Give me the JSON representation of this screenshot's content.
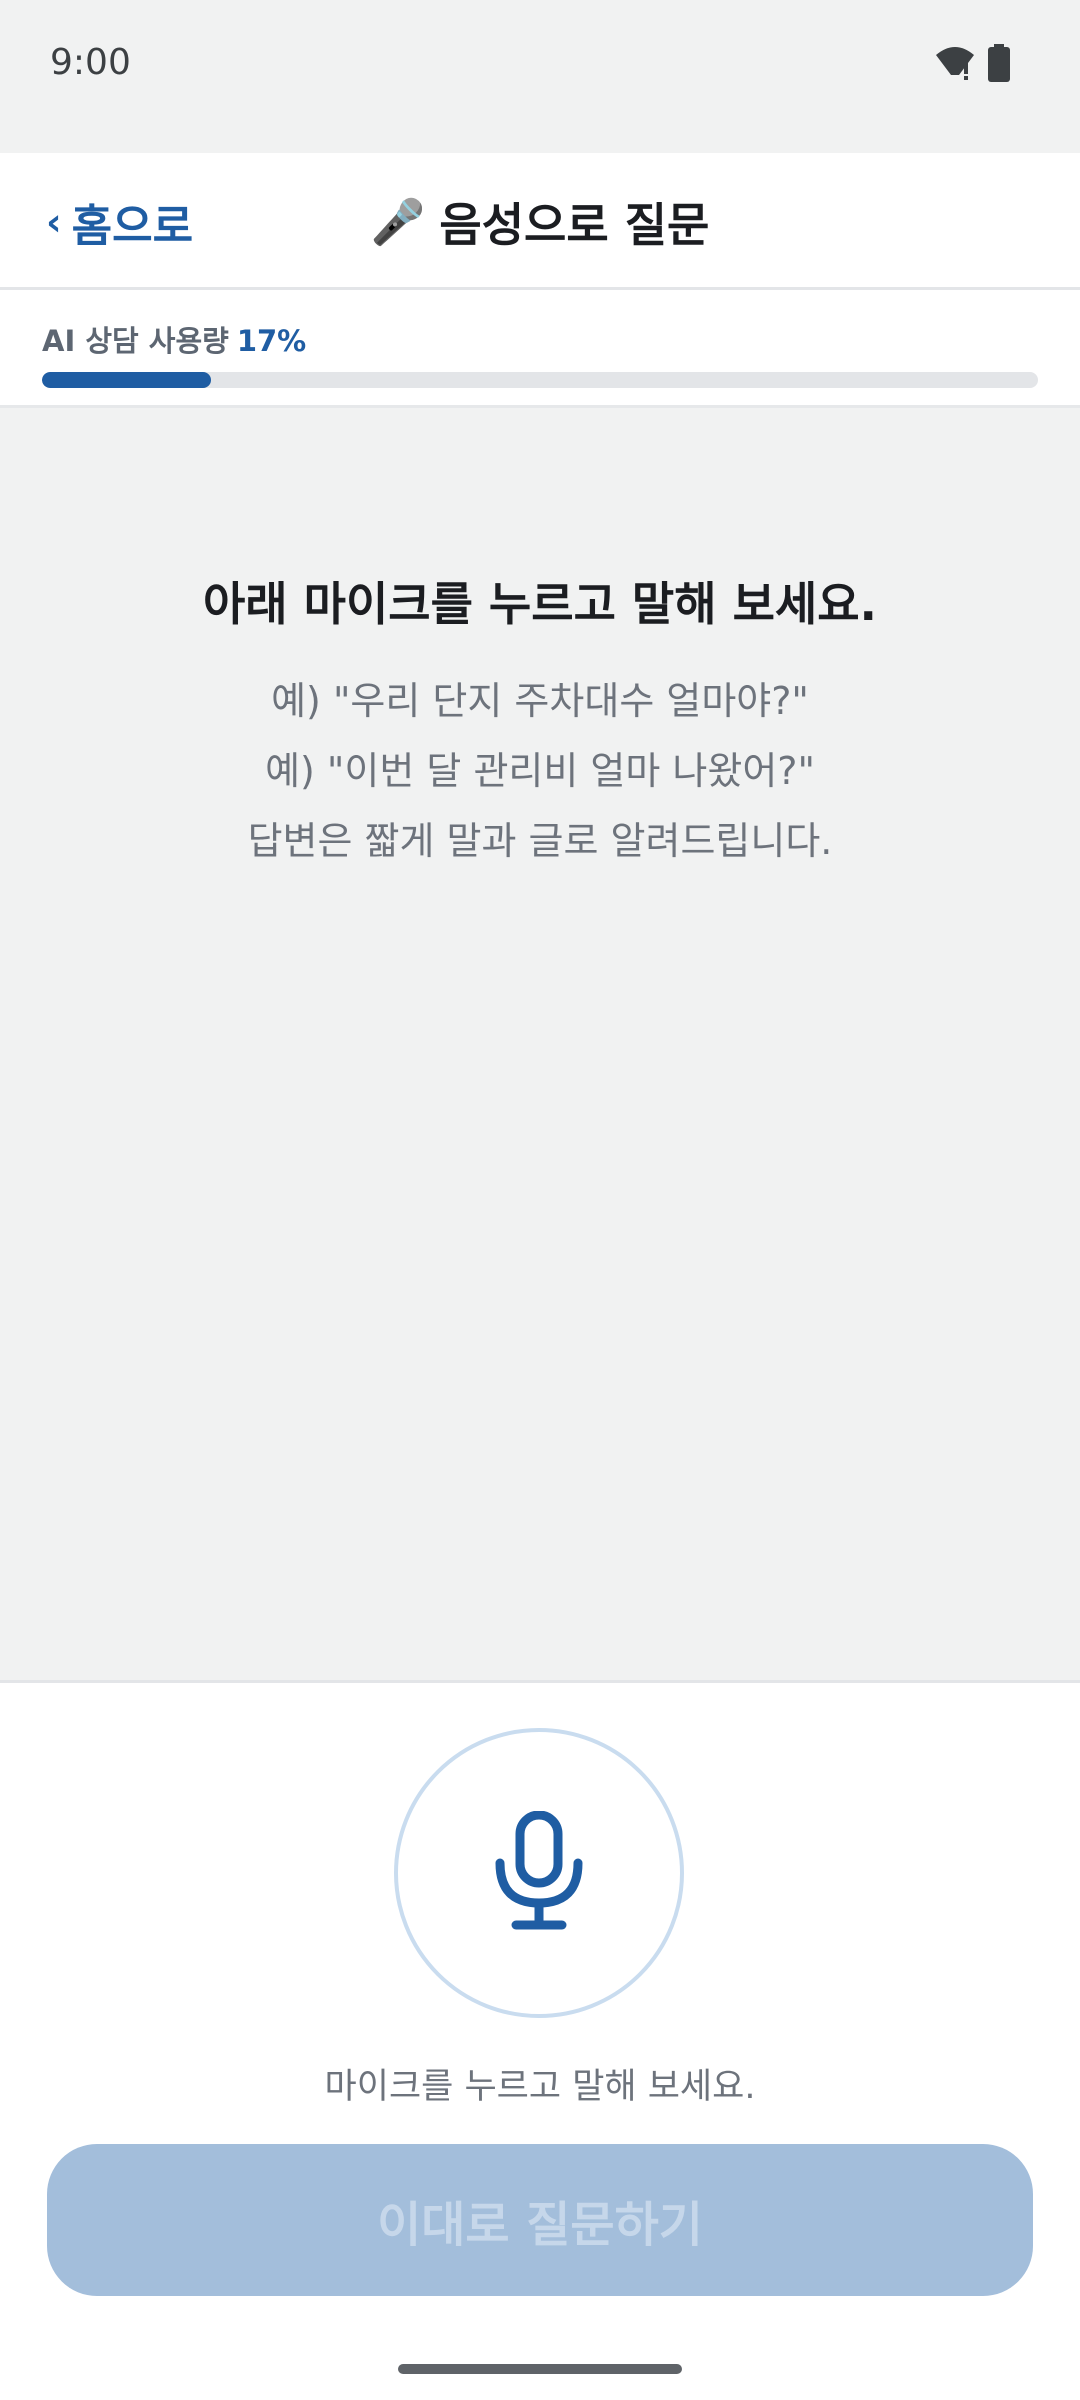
{
  "status_bar": {
    "time": "9:00",
    "icons": [
      "wifi-alert-icon",
      "battery-icon"
    ]
  },
  "header": {
    "back_chevron": "‹",
    "back_label": "홈으로",
    "title_icon": "🎤",
    "title": "음성으로 질문"
  },
  "usage": {
    "label": "AI 상담 사용량",
    "percent_text": "17%",
    "fraction": 0.17
  },
  "content": {
    "prompt_title": "아래 마이크를 누르고 말해 보세요.",
    "examples": [
      "예) \"우리 단지 주차대수 얼마야?\"",
      "예) \"이번 달 관리비 얼마 나왔어?\"",
      "답변은 짧게 말과 글로 알려드립니다."
    ]
  },
  "bottom": {
    "mic_hint": "마이크를 누르고 말해 보세요.",
    "submit_label": "이대로 질문하기"
  },
  "colors": {
    "accent": "#1f5da3",
    "mic_ring": "#c9dcef",
    "button_disabled": "#a3bedb",
    "content_bg": "#f1f2f2"
  }
}
